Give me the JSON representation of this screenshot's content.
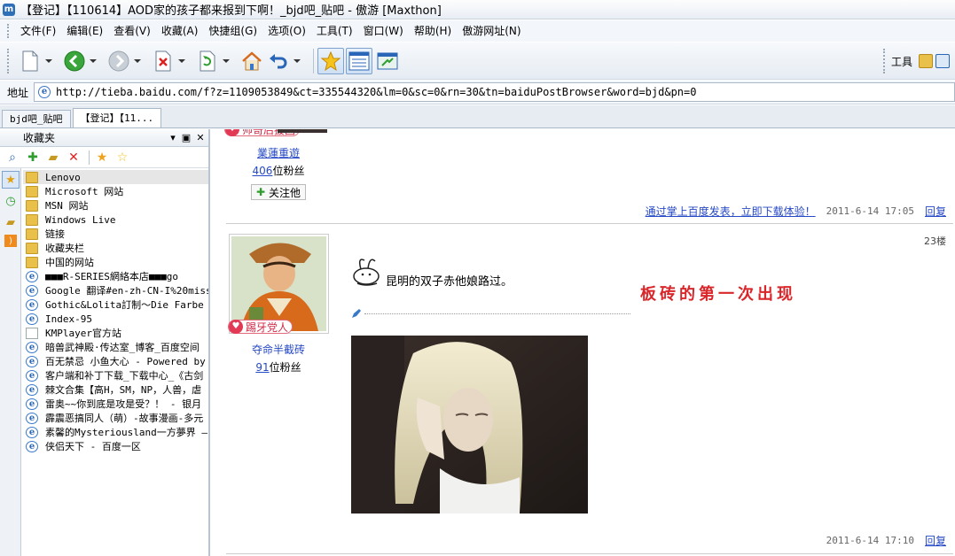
{
  "window": {
    "title": "【登记】【110614】AOD家的孩子都来报到下啊！_bjd吧_贴吧 - 傲游 [Maxthon]"
  },
  "menu": [
    "文件(F)",
    "编辑(E)",
    "查看(V)",
    "收藏(A)",
    "快捷组(G)",
    "选项(O)",
    "工具(T)",
    "窗口(W)",
    "帮助(H)",
    "傲游网址(N)"
  ],
  "toolbar": {
    "tools_label": "工具"
  },
  "address": {
    "label": "地址",
    "url": "http://tieba.baidu.com/f?z=1109053849&ct=335544320&lm=0&sc=0&rn=30&tn=baiduPostBrowser&word=bjd&pn=0"
  },
  "tabs": [
    {
      "label": "bjd吧_贴吧"
    },
    {
      "label": "【登记】【11..."
    }
  ],
  "sidebar": {
    "title": "收藏夹",
    "items": [
      {
        "label": "Lenovo",
        "icon": "folder"
      },
      {
        "label": "Microsoft 网站",
        "icon": "folder"
      },
      {
        "label": "MSN 网站",
        "icon": "folder"
      },
      {
        "label": "Windows Live",
        "icon": "folder"
      },
      {
        "label": "链接",
        "icon": "folder"
      },
      {
        "label": "收藏夹栏",
        "icon": "folder"
      },
      {
        "label": "中国的网站",
        "icon": "folder"
      },
      {
        "label": "■■■R-SERIES網絡本店■■■go",
        "icon": "ie"
      },
      {
        "label": "Google 翻译#en-zh-CN-I%20miss%",
        "icon": "ie"
      },
      {
        "label": "Gothic&Lolita訂制～Die Farbe El",
        "icon": "ie"
      },
      {
        "label": "Index-95",
        "icon": "ie"
      },
      {
        "label": "KMPlayer官方站",
        "icon": "page"
      },
      {
        "label": "暗兽武神殿·传达室_博客_百度空间",
        "icon": "ie"
      },
      {
        "label": "百无禁忌 小鱼大心 - Powered by",
        "icon": "ie"
      },
      {
        "label": "客户端和补丁下载_下载中心_《古剑",
        "icon": "ie"
      },
      {
        "label": "棘文合集【高H，SM，NP，人兽，虐",
        "icon": "ie"
      },
      {
        "label": "雷奥~~你到底是攻是受？！ - 银月",
        "icon": "ie"
      },
      {
        "label": "霹震恶搞同人（萌）-故事漫画-多元",
        "icon": "ie"
      },
      {
        "label": "素馨的Mysteriousland一方夢界 —",
        "icon": "ie"
      },
      {
        "label": "侠侣天下 - 百度一区",
        "icon": "ie"
      }
    ]
  },
  "posts": [
    {
      "badge": "帅哥后援团",
      "username": "業蓮重遊",
      "fans_count": "406",
      "fans_suffix": "位粉丝",
      "follow_label": "关注他",
      "promo": "通过掌上百度发表，立即下载体验！",
      "date": "2011-6-14 17:05",
      "reply": "回复"
    },
    {
      "floor": "23楼",
      "badge": "踢牙党人",
      "username": "夺命半截砖",
      "fans_count": "91",
      "fans_suffix": "位粉丝",
      "text": "昆明的双子赤他娘路过。",
      "overlay": "板砖的第一次出现",
      "date": "2011-6-14 17:10",
      "reply": "回复"
    }
  ]
}
